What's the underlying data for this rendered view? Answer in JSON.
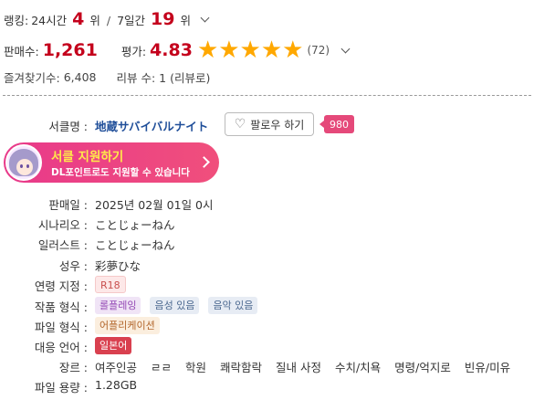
{
  "ranking": {
    "label": "랭킹:",
    "period1": "24시간",
    "rank1": "4",
    "unit": "위",
    "sep": "/",
    "period2": "7일간",
    "rank2": "19"
  },
  "sales": {
    "label": "판매수:",
    "value": "1,261",
    "rating_label": "평가:",
    "rating": "4.83",
    "stars": "★★★★★",
    "rating_count": "(72)"
  },
  "favorites": {
    "label": "즐겨찾기수:",
    "value": "6,408",
    "review": "리뷰 수: 1 (리뷰로)"
  },
  "maker": {
    "label": "서클명 :",
    "name": "地蔵サバイバルナイト",
    "follow_label": "팔로우 하기",
    "follow_count": "980"
  },
  "banner": {
    "title": "서클 지원하기",
    "subtitle": "DL포인트로도 지원할 수 있습니다"
  },
  "details": {
    "release_label": "판매일 :",
    "release_value": "2025년 02월 01일 0시",
    "scenario_label": "시나리오 :",
    "scenario_value": "ことじょーねん",
    "illust_label": "일러스트 :",
    "illust_value": "ことじょーねん",
    "voice_label": "성우 :",
    "voice_value": "彩夢ひな",
    "age_label": "연령 지정 :",
    "age_value": "R18",
    "type_label": "작품 형식 :",
    "type_values": [
      "롤플레잉",
      "음성 있음",
      "음악 있음"
    ],
    "format_label": "파일 형식 :",
    "format_value": "어플리케이션",
    "lang_label": "대응 언어 :",
    "lang_value": "일본어",
    "genre_label": "장르 :",
    "genres": [
      "여주인공",
      "ㄹㄹ",
      "학원",
      "쾌락함락",
      "질내 사정",
      "수치/치욕",
      "명령/억지로",
      "빈유/미유"
    ],
    "size_label": "파일 용량 :",
    "size_value": "1.28GB"
  },
  "colors": {
    "accent_red": "#c4001c",
    "star": "#ffa800",
    "banner_pink": "#e8398a",
    "badge_pink": "#e5497a",
    "maker_blue": "#1f4e99"
  }
}
